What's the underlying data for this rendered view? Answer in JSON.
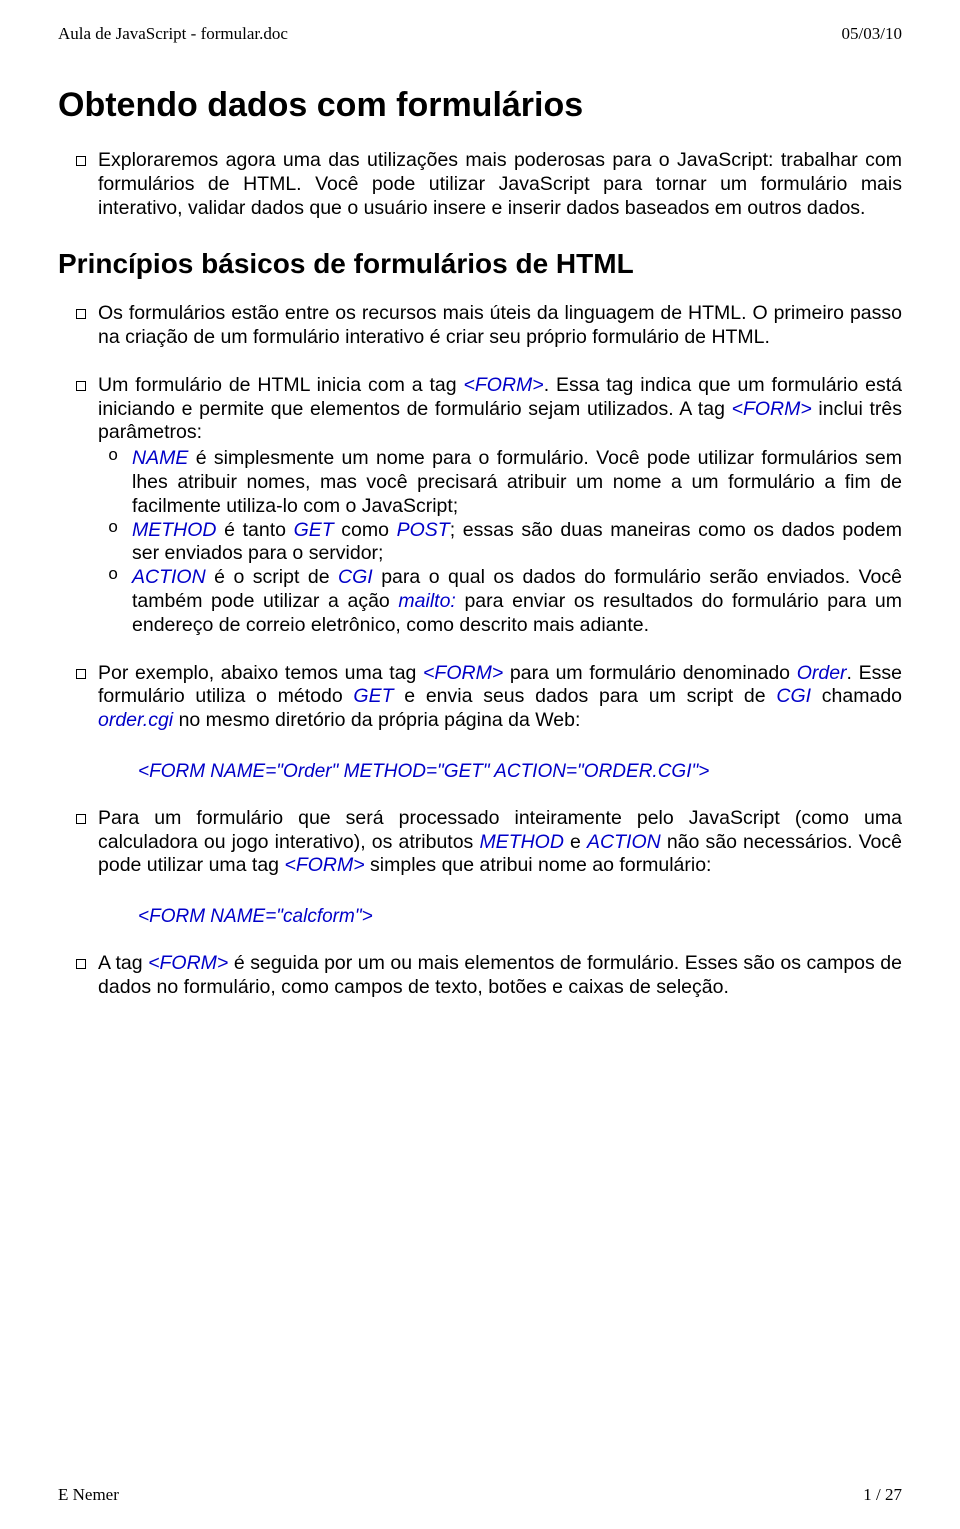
{
  "header": {
    "left": "Aula de JavaScript - formular.doc",
    "right": "05/03/10"
  },
  "h1": "Obtendo dados com formulários",
  "intro": {
    "p1a": "Exploraremos agora uma das utilizações mais poderosas para o JavaScript: trabalhar com formulários de HTML. Você pode utilizar JavaScript para tornar um formulário mais interativo, validar dados que o usuário insere e inserir dados baseados em outros dados."
  },
  "h2": "Princípios básicos de formulários de HTML",
  "b1": "Os formulários estão entre os recursos mais úteis da linguagem de HTML. O primeiro passo na criação de um formulário interativo é criar seu próprio formulário de HTML.",
  "b2": {
    "lead1": "Um formulário de HTML inicia com a tag ",
    "form1": "<FORM>",
    "lead2": ". Essa tag indica que um formulário está iniciando e permite que elementos de formulário sejam utilizados. A tag ",
    "form2": "<FORM>",
    "lead3": " inclui três parâmetros:"
  },
  "sub1": {
    "name": "NAME",
    "txt": " é simplesmente um nome para o formulário. Você pode utilizar formulários sem lhes atribuir nomes, mas você precisará atribuir um nome a um formulário a fim de facilmente utiliza-lo com o JavaScript;"
  },
  "sub2": {
    "method": "METHOD",
    "t1": " é tanto ",
    "get": "GET",
    "t2": " como ",
    "post": "POST",
    "t3": "; essas são duas maneiras como os dados podem ser enviados para o servidor;"
  },
  "sub3": {
    "action": "ACTION",
    "t1": " é o script de ",
    "cgi": "CGI",
    "t2": " para o qual os dados do formulário serão enviados. Você também pode utilizar a ação ",
    "mailto": "mailto:",
    "t3": " para enviar os resultados do formulário para um endereço de correio eletrônico, como descrito mais adiante."
  },
  "b3": {
    "t1": "Por exemplo, abaixo temos uma tag ",
    "form": "<FORM>",
    "t2": " para um formulário denominado ",
    "order": "Order",
    "t3": ". Esse formulário utiliza o método ",
    "get": "GET",
    "t4": " e envia seus dados para um script de ",
    "cgi": "CGI",
    "t5": " chamado ",
    "ordercgi": "order.cgi",
    "t6": " no mesmo diretório da própria página da Web:"
  },
  "code1": "<FORM NAME=\"Order\" METHOD=\"GET\" ACTION=\"ORDER.CGI\">",
  "b4": {
    "t1": "Para um formulário que será processado inteiramente pelo JavaScript (como uma calculadora ou jogo interativo), os atributos ",
    "method": "METHOD",
    "t2": " e ",
    "action": "ACTION",
    "t3": " não são necessários. Você pode utilizar uma tag ",
    "form": "<FORM>",
    "t4": " simples que atribui nome ao formulário:"
  },
  "code2": "<FORM NAME=\"calcform\">",
  "b5": {
    "t1": "A tag ",
    "form": "<FORM>",
    "t2": " é seguida por um ou mais elementos de formulário. Esses são os campos de dados no formulário, como campos de texto, botões e caixas de seleção."
  },
  "footer": {
    "left": "E Nemer",
    "right": "1 / 27"
  }
}
